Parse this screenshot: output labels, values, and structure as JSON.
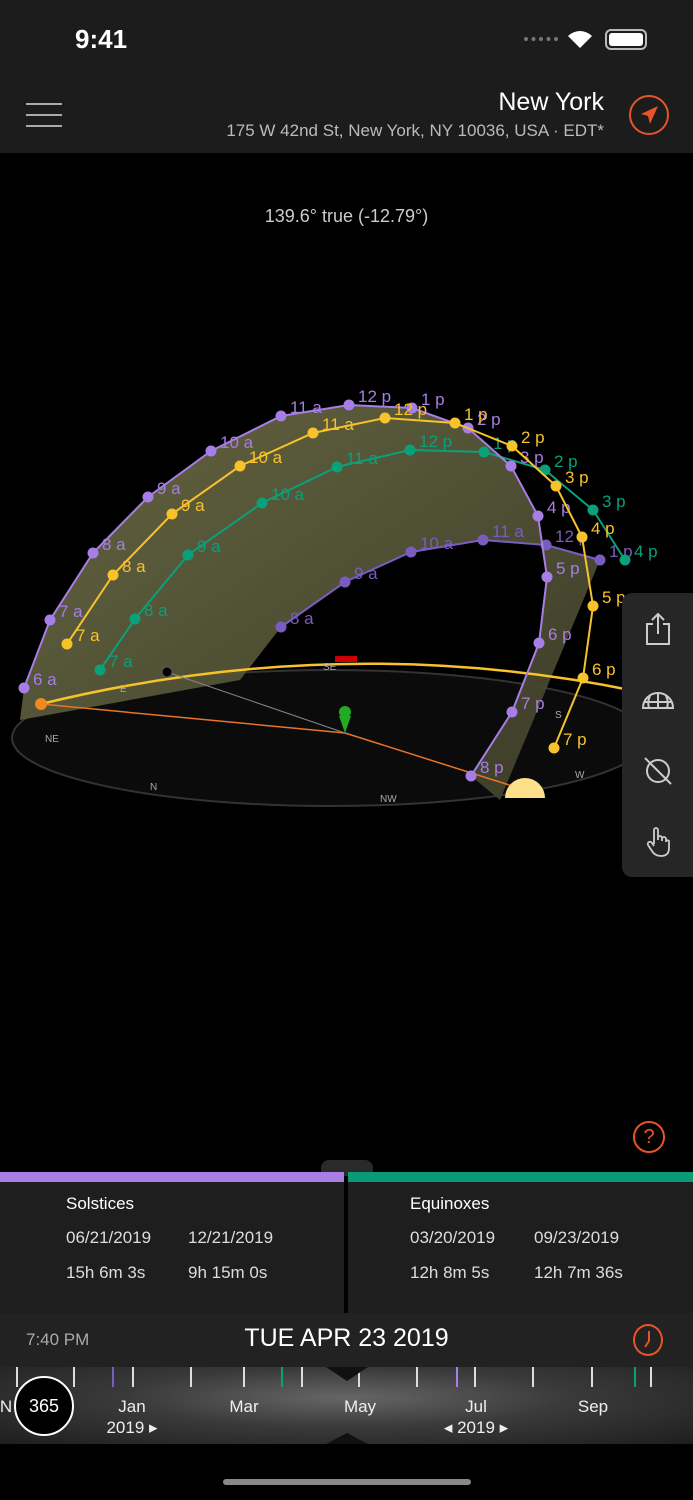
{
  "status": {
    "time": "9:41"
  },
  "header": {
    "city": "New York",
    "address": "175 W 42nd St, New York, NY 10036, USA · EDT*"
  },
  "azimuth": "139.6° true (-12.79°)",
  "paths": {
    "summer": {
      "color": "#a77de6",
      "labels": [
        "6 a",
        "7 a",
        "8 a",
        "9 a",
        "10 a",
        "11 a",
        "12 p",
        "1 p",
        "2 p",
        "3 p",
        "4 p",
        "5 p",
        "6 p",
        "7 p",
        "8 p"
      ]
    },
    "today": {
      "color": "#f8c22a",
      "labels": [
        "7 a",
        "8 a",
        "9 a",
        "10 a",
        "11 a",
        "12 p",
        "1 p",
        "2 p",
        "3 p",
        "4 p",
        "5 p",
        "6 p",
        "7 p"
      ]
    },
    "equinox": {
      "color": "#0aa07a",
      "labels": [
        "7 a",
        "8 a",
        "9 a",
        "10 a",
        "11 a",
        "12 p",
        "1 p",
        "2 p",
        "3 p",
        "4 p"
      ]
    },
    "winter": {
      "color": "#7a5cc0",
      "labels": [
        "8 a",
        "9 a",
        "10 a",
        "11 a",
        "12 p",
        "1 p"
      ]
    }
  },
  "compass": [
    "E",
    "SE",
    "S",
    "W",
    "NW",
    "N",
    "NE"
  ],
  "solstices": {
    "title": "Solstices",
    "dates": [
      "06/21/2019",
      "12/21/2019"
    ],
    "durations": [
      "15h 6m 3s",
      "9h 15m 0s"
    ]
  },
  "equinoxes": {
    "title": "Equinoxes",
    "dates": [
      "03/20/2019",
      "09/23/2019"
    ],
    "durations": [
      "12h 8m 5s",
      "12h 7m 36s"
    ]
  },
  "datebar": {
    "time": "7:40 PM",
    "date": "TUE APR 23 2019"
  },
  "timeline": {
    "days": "365",
    "months": [
      "N",
      "Jan",
      "Mar",
      "May",
      "Jul",
      "Sep"
    ],
    "year_left": "2019 ▸",
    "year_center": "◂ 2019 ▸"
  },
  "help": "?"
}
